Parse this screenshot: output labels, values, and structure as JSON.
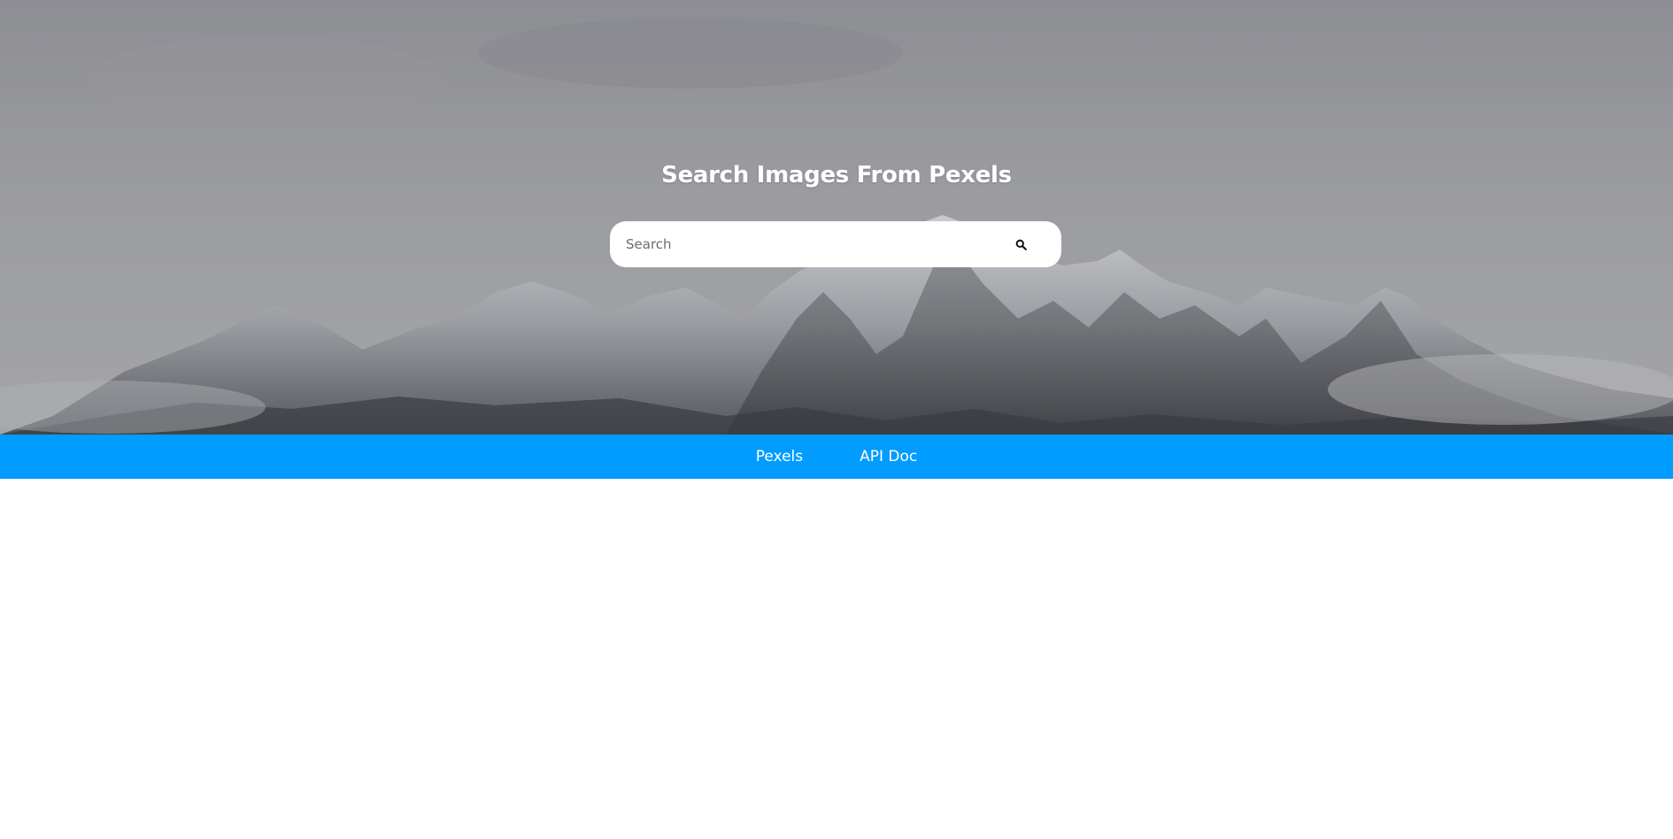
{
  "hero": {
    "title": "Search Images From Pexels",
    "background_image": "snowy-mountain-range"
  },
  "search": {
    "placeholder": "Search",
    "value": "",
    "button_icon": "search-icon"
  },
  "nav": {
    "links": [
      {
        "label": "Pexels"
      },
      {
        "label": "API Doc"
      }
    ]
  },
  "colors": {
    "nav_background": "#009cff",
    "title_text": "#ffffff",
    "nav_text": "#ffffff"
  }
}
